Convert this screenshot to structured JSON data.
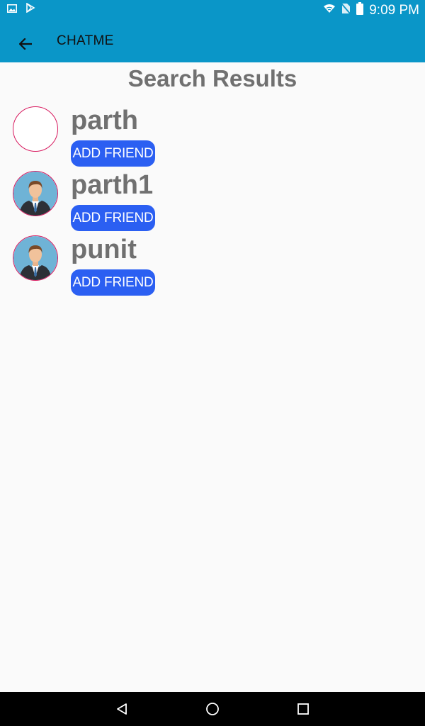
{
  "status_bar": {
    "time": "9:09 PM",
    "icons": [
      "image-icon",
      "play-store-icon",
      "wifi-icon",
      "no-sim-icon",
      "battery-icon"
    ]
  },
  "app_bar": {
    "title": "CHATME",
    "back_icon": "arrow-back-icon"
  },
  "page": {
    "title": "Search Results"
  },
  "results": [
    {
      "name": "parth",
      "avatar": "blank",
      "button_label": "ADD FRIEND"
    },
    {
      "name": "parth1",
      "avatar": "man-in-suit",
      "button_label": "ADD FRIEND"
    },
    {
      "name": "punit",
      "avatar": "man-in-suit",
      "button_label": "ADD FRIEND"
    }
  ],
  "nav_bar": {
    "buttons": [
      "back-triangle-icon",
      "home-circle-icon",
      "recents-square-icon"
    ]
  },
  "colors": {
    "primary": "#0a96c8",
    "button": "#2b5ff2",
    "avatar_border": "#d81b60",
    "text_gray": "#707070"
  }
}
